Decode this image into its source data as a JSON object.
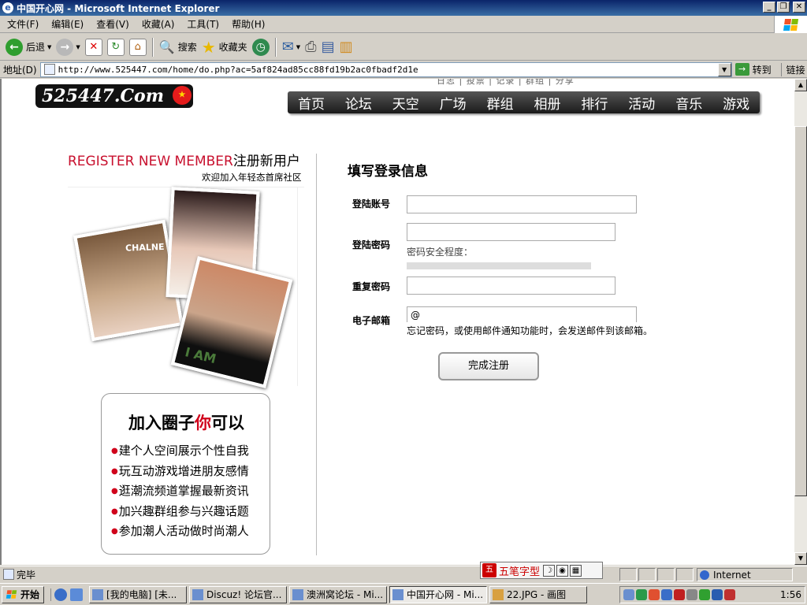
{
  "window": {
    "title": "中国开心网 - Microsoft Internet Explorer",
    "ie_icon_glyph": "e",
    "min_glyph": "_",
    "restore_glyph": "❐",
    "close_glyph": "✕"
  },
  "menubar": {
    "items": [
      "文件(F)",
      "编辑(E)",
      "查看(V)",
      "收藏(A)",
      "工具(T)",
      "帮助(H)"
    ]
  },
  "toolbar": {
    "back_label": "后退",
    "search_label": "搜索",
    "favorites_label": "收藏夹",
    "back_glyph": "←",
    "forward_glyph": "→",
    "stop_glyph": "✕",
    "refresh_glyph": "↻",
    "home_glyph": "⌂",
    "search_glyph": "🔍",
    "favorites_glyph": "★",
    "history_glyph": "◷",
    "mail_glyph": "✉",
    "print_glyph": "⎙",
    "edit_glyph": "▤",
    "messenger_glyph": "▥",
    "dropdown_glyph": "▼"
  },
  "addressbar": {
    "label": "地址(D)",
    "url": "http://www.525447.com/home/do.php?ac=5af824ad85cc88fd19b2ac0fbadf2d1e",
    "dropdown_glyph": "▼",
    "go_label": "转到",
    "go_glyph": "→",
    "links_label": "链接"
  },
  "site": {
    "logo_text": "525447.Com",
    "top_links": "日志 | 投票 | 记录 | 群组 | 分享",
    "nav": [
      "首页",
      "论坛",
      "天空",
      "广场",
      "群组",
      "相册",
      "排行",
      "活动",
      "音乐",
      "游戏"
    ]
  },
  "register": {
    "title_en": "REGISTER NEW MEMBER",
    "title_cn": "注册新用户",
    "subtitle": "欢迎加入年轻态首席社区",
    "photo1_caption": "CHALNE",
    "photo3_caption": "I AM"
  },
  "join": {
    "title_pre": "加入圈子",
    "title_red": "你",
    "title_post": "可以",
    "items": [
      "建个人空间展示个性自我",
      "玩互动游戏增进朋友感情",
      "逛潮流频道掌握最新资讯",
      "加兴趣群组参与兴趣话题",
      "参加潮人活动做时尚潮人"
    ]
  },
  "form": {
    "title": "填写登录信息",
    "account_label": "登陆账号",
    "account_value": "",
    "password_label": "登陆密码",
    "password_value": "",
    "password_strength_label": "密码安全程度：",
    "password_strength": 0,
    "repeat_label": "重复密码",
    "repeat_value": "",
    "email_label": "电子邮箱",
    "email_value": "@",
    "email_hint": "忘记密码，或使用邮件通知功能时，会发送邮件到该邮箱。",
    "submit_label": "完成注册"
  },
  "statusbar": {
    "text": "完毕",
    "zone": "Internet"
  },
  "ime": {
    "seal": "五",
    "name": "五笔字型",
    "moon_glyph": "☽",
    "dot_glyph": "◉",
    "keyboard_glyph": "▦"
  },
  "taskbar": {
    "start_label": "开始",
    "tasks": [
      "[我的电脑] [未...",
      "Discuz! 论坛官...",
      "澳洲窝论坛 - Mi...",
      "中国开心网 - Mi...",
      "22.JPG - 画图"
    ],
    "active_task_index": 3,
    "clock": "1:56"
  },
  "colors": {
    "title_bar": "#0a246a",
    "register_red": "#c8102e",
    "nav_bg": "#1a1a1a",
    "bullet_red": "#d0021b"
  }
}
